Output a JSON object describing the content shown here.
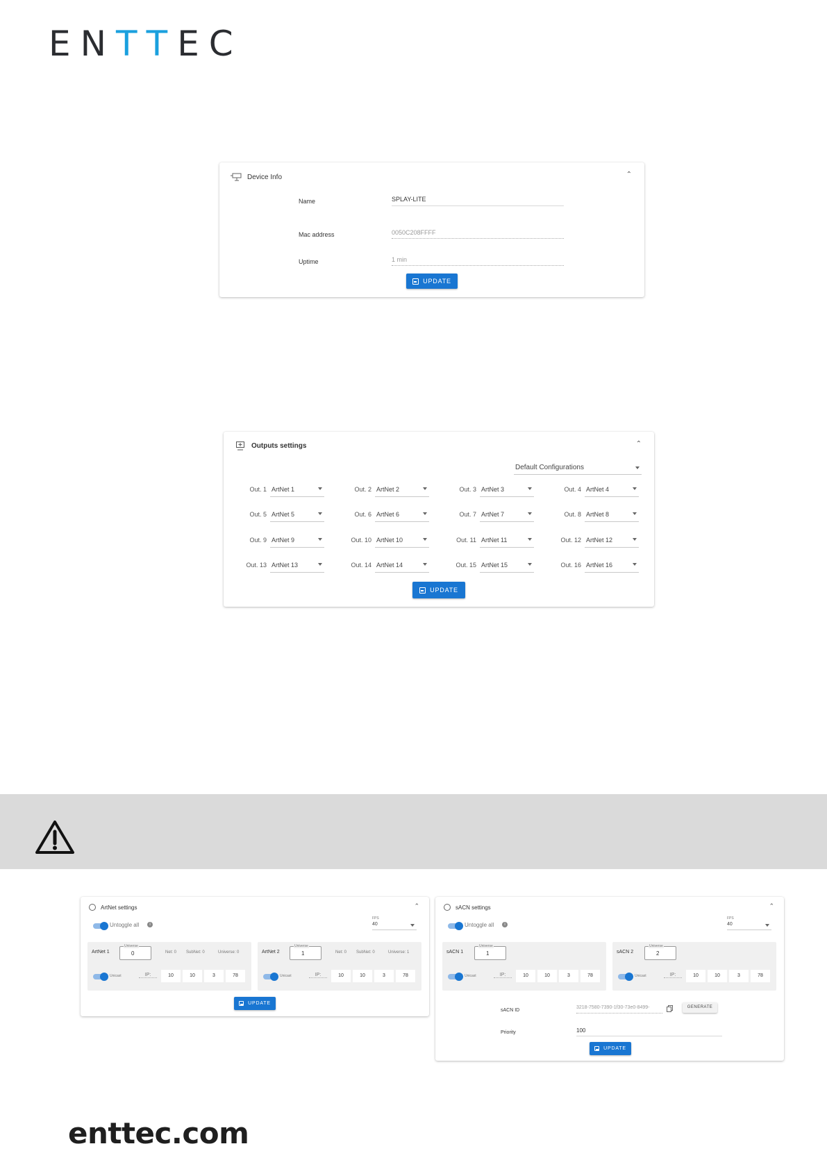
{
  "brand": {
    "logo_part1": "EN",
    "logo_part2": "TT",
    "logo_part3": "EC",
    "accent_color": "#1aa0de",
    "footer": "enttec.com"
  },
  "device_info": {
    "title": "Device Info",
    "fields": [
      {
        "label": "Name",
        "value": "SPLAY-LITE"
      },
      {
        "label": "Mac address",
        "value": "0050C208FFFF"
      },
      {
        "label": "Uptime",
        "value": "1 min"
      }
    ],
    "button": "UPDATE"
  },
  "outputs": {
    "title": "Outputs settings",
    "config_select": "Default Configurations",
    "rows": [
      [
        {
          "label": "Out. 1",
          "value": "ArtNet 1"
        },
        {
          "label": "Out. 2",
          "value": "ArtNet 2"
        },
        {
          "label": "Out. 3",
          "value": "ArtNet 3"
        },
        {
          "label": "Out. 4",
          "value": "ArtNet 4"
        }
      ],
      [
        {
          "label": "Out. 5",
          "value": "ArtNet 5"
        },
        {
          "label": "Out. 6",
          "value": "ArtNet 6"
        },
        {
          "label": "Out. 7",
          "value": "ArtNet 7"
        },
        {
          "label": "Out. 8",
          "value": "ArtNet 8"
        }
      ],
      [
        {
          "label": "Out. 9",
          "value": "ArtNet 9"
        },
        {
          "label": "Out. 10",
          "value": "ArtNet 10"
        },
        {
          "label": "Out. 11",
          "value": "ArtNet 11"
        },
        {
          "label": "Out. 12",
          "value": "ArtNet 12"
        }
      ],
      [
        {
          "label": "Out. 13",
          "value": "ArtNet 13"
        },
        {
          "label": "Out. 14",
          "value": "ArtNet 14"
        },
        {
          "label": "Out. 15",
          "value": "ArtNet 15"
        },
        {
          "label": "Out. 16",
          "value": "ArtNet 16"
        }
      ]
    ],
    "button": "UPDATE"
  },
  "artnet": {
    "title": "ArtNet settings",
    "untoggle": "Untoggle all",
    "fps_label": "FPS",
    "fps_value": "40",
    "universe_caption": "Universe",
    "blocks": [
      {
        "name": "ArtNet 1",
        "universe": "0",
        "net": "Net: 0",
        "subnet": "SubNet: 0",
        "universe_text": "Universe: 0",
        "unicast": "Unicast",
        "ip_label": "IP:",
        "ip": [
          "10",
          "10",
          "3",
          "78"
        ]
      },
      {
        "name": "ArtNet 2",
        "universe": "1",
        "net": "Net: 0",
        "subnet": "SubNet: 0",
        "universe_text": "Universe: 1",
        "unicast": "Unicast",
        "ip_label": "IP:",
        "ip": [
          "10",
          "10",
          "3",
          "78"
        ]
      }
    ],
    "button": "UPDATE"
  },
  "sacn": {
    "title": "sACN settings",
    "untoggle": "Untoggle all",
    "fps_label": "FPS",
    "fps_value": "40",
    "universe_caption": "Universe",
    "blocks": [
      {
        "name": "sACN 1",
        "universe": "1",
        "unicast": "Unicast",
        "ip_label": "IP:",
        "ip": [
          "10",
          "10",
          "3",
          "78"
        ]
      },
      {
        "name": "sACN 2",
        "universe": "2",
        "unicast": "Unicast",
        "ip_label": "IP:",
        "ip": [
          "10",
          "10",
          "3",
          "78"
        ]
      }
    ],
    "id_label": "sACN ID",
    "id_value": "3218-7580-7390-1f30-73e0-8499-",
    "generate": "GENERATE",
    "priority_label": "Priority",
    "priority_value": "100",
    "button": "UPDATE"
  }
}
